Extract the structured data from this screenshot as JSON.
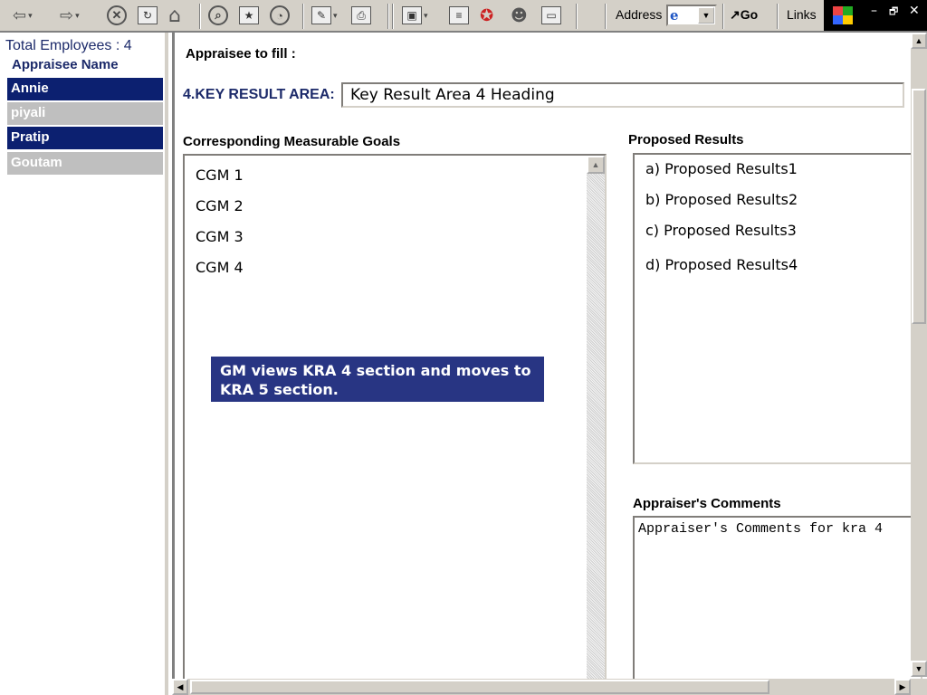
{
  "browser": {
    "address_label": "Address",
    "go_label": "Go",
    "links_label": "Links",
    "win_controls": [
      "–",
      "🗗",
      "✕"
    ],
    "icons": [
      "back-arrow-icon",
      "forward-arrow-icon",
      "stop-icon",
      "refresh-icon",
      "home-icon",
      "search-icon",
      "favorites-icon",
      "history-icon",
      "edit-icon",
      "print-icon",
      "frame-icon",
      "document-icon",
      "award-icon",
      "user-icon",
      "window-icon"
    ]
  },
  "left_frame": {
    "total_employees": "Total Employees : 4",
    "appraisee_header": "Appraisee Name",
    "employees": [
      {
        "name": "Annie",
        "style": "blue"
      },
      {
        "name": "piyali",
        "style": "grey"
      },
      {
        "name": "Pratip",
        "style": "blue"
      },
      {
        "name": "Goutam",
        "style": "grey"
      }
    ]
  },
  "main": {
    "fill_label": "Appraisee to fill :",
    "kra_label": "4.KEY RESULT AREA:",
    "kra_value": "Key Result Area 4 Heading",
    "cmg_label": "Corresponding Measurable Goals",
    "cmg_items": [
      "CGM 1",
      "CGM 2",
      "CGM 3",
      "CGM 4"
    ],
    "callout": "GM views KRA 4 section and moves to KRA 5 section.",
    "proposed_label": "Proposed Results",
    "proposed_items": [
      "a) Proposed Results1",
      "b) Proposed Results2",
      "c) Proposed Results3",
      "d) Proposed Results4"
    ],
    "comments_label": "Appraiser's Comments",
    "comments_value": "Appraiser's Comments for kra 4"
  },
  "colors": {
    "selected_blue": "#0c2070",
    "unselected_grey": "#bfbfbf",
    "callout_bg": "#283583",
    "label_navy": "#1c2a6a"
  }
}
